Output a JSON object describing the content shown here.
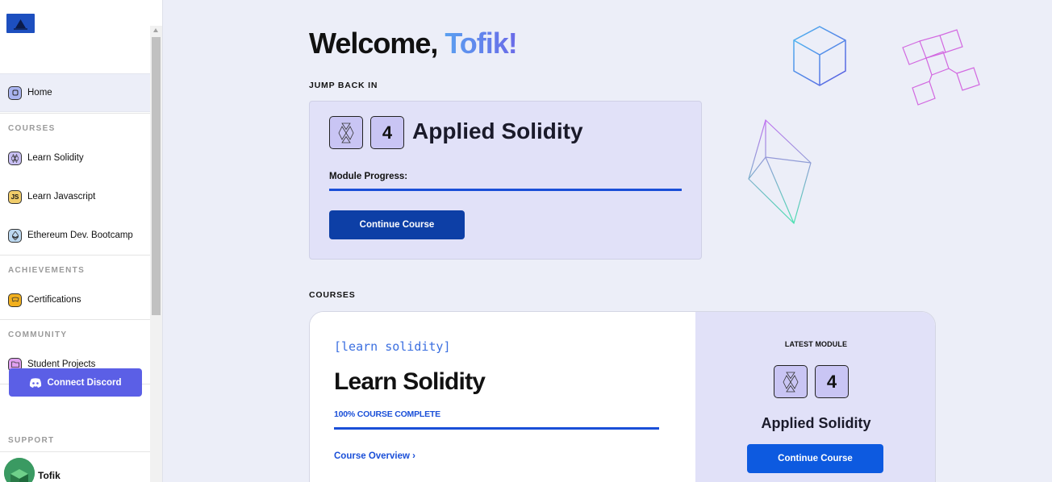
{
  "sidebar": {
    "nav": {
      "home": {
        "label": "Home",
        "icon": "home-icon"
      }
    },
    "sections": {
      "courses": "COURSES",
      "achievements": "ACHIEVEMENTS",
      "community": "COMMUNITY",
      "support": "SUPPORT"
    },
    "courses": [
      {
        "label": "Learn Solidity",
        "icon": "solidity-icon"
      },
      {
        "label": "Learn Javascript",
        "icon": "javascript-icon"
      },
      {
        "label": "Ethereum Dev. Bootcamp",
        "icon": "ethereum-icon"
      }
    ],
    "achievements": [
      {
        "label": "Certifications",
        "icon": "certificate-icon"
      }
    ],
    "community": [
      {
        "label": "Student Projects",
        "icon": "folder-icon"
      }
    ],
    "discord_button": "Connect Discord",
    "user": {
      "name": "Tofik"
    }
  },
  "main": {
    "greeting": "Welcome,",
    "user_name": "Tofik!",
    "jump_back": {
      "label": "JUMP BACK IN",
      "module_number": "4",
      "module_title": "Applied Solidity",
      "progress_label": "Module Progress:",
      "progress": 1.0,
      "button": "Continue Course"
    },
    "courses": {
      "label": "COURSES",
      "card": {
        "tag": "[learn solidity]",
        "title": "Learn Solidity",
        "complete_text": "100% COURSE COMPLETE",
        "progress": 1.0,
        "overview_link": "Course Overview ›",
        "latest_label": "LATEST MODULE",
        "module_number": "4",
        "module_title": "Applied Solidity",
        "button": "Continue Course"
      }
    }
  },
  "colors": {
    "accent": "#1a4fd8",
    "dark_button": "#0d3fa6",
    "discord": "#5b5fe6",
    "card_bg": "#e1e1f8",
    "page_bg": "#eceef8"
  }
}
